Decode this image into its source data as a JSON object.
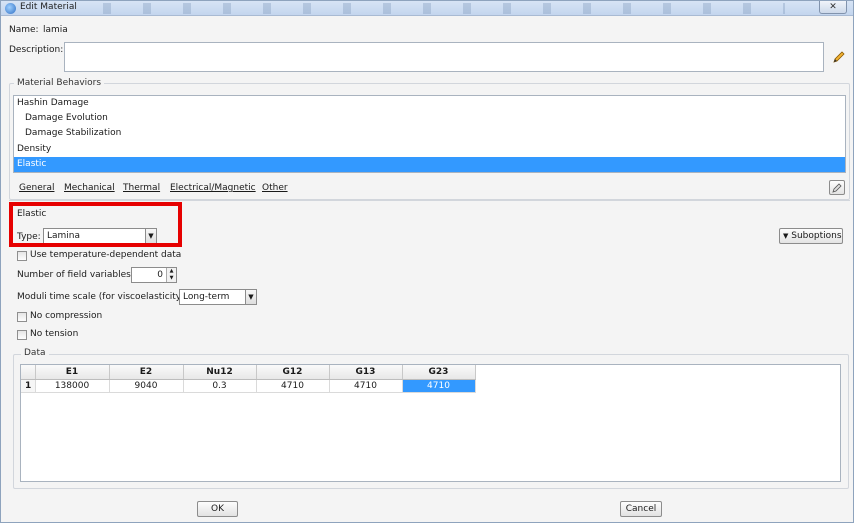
{
  "window": {
    "title": "Edit Material",
    "close_label": "✕"
  },
  "name": {
    "label": "Name:",
    "value": "lamia"
  },
  "description": {
    "label": "Description:",
    "value": ""
  },
  "behaviors": {
    "group_title": "Material Behaviors",
    "items": [
      {
        "label": "Hashin Damage"
      },
      {
        "label": "Damage Evolution"
      },
      {
        "label": "Damage Stabilization"
      },
      {
        "label": "Density"
      },
      {
        "label": "Elastic"
      }
    ],
    "selected": "Elastic"
  },
  "menu": {
    "items": [
      {
        "label": "General"
      },
      {
        "label": "Mechanical"
      },
      {
        "label": "Thermal"
      },
      {
        "label": "Electrical/Magnetic"
      },
      {
        "label": "Other"
      }
    ]
  },
  "elastic": {
    "section_title": "Elastic",
    "type_label": "Type:",
    "type_value": "Lamina",
    "suboptions_label": "Suboptions",
    "use_temp_label": "Use temperature-dependent data",
    "field_vars_label": "Number of field variables:",
    "field_vars_value": "0",
    "moduli_label": "Moduli time scale (for viscoelasticity):",
    "moduli_value": "Long-term",
    "no_compression_label": "No compression",
    "no_tension_label": "No tension"
  },
  "data": {
    "group_title": "Data",
    "columns": [
      "E1",
      "E2",
      "Nu12",
      "G12",
      "G13",
      "G23"
    ],
    "rows": [
      {
        "index": "1",
        "values": [
          "138000",
          "9040",
          "0.3",
          "4710",
          "4710",
          "4710"
        ]
      }
    ],
    "selected_cell": "G23"
  },
  "footer": {
    "ok_label": "OK",
    "cancel_label": "Cancel"
  },
  "colors": {
    "selection": "#3399ff",
    "highlight_box": "#e60000"
  }
}
